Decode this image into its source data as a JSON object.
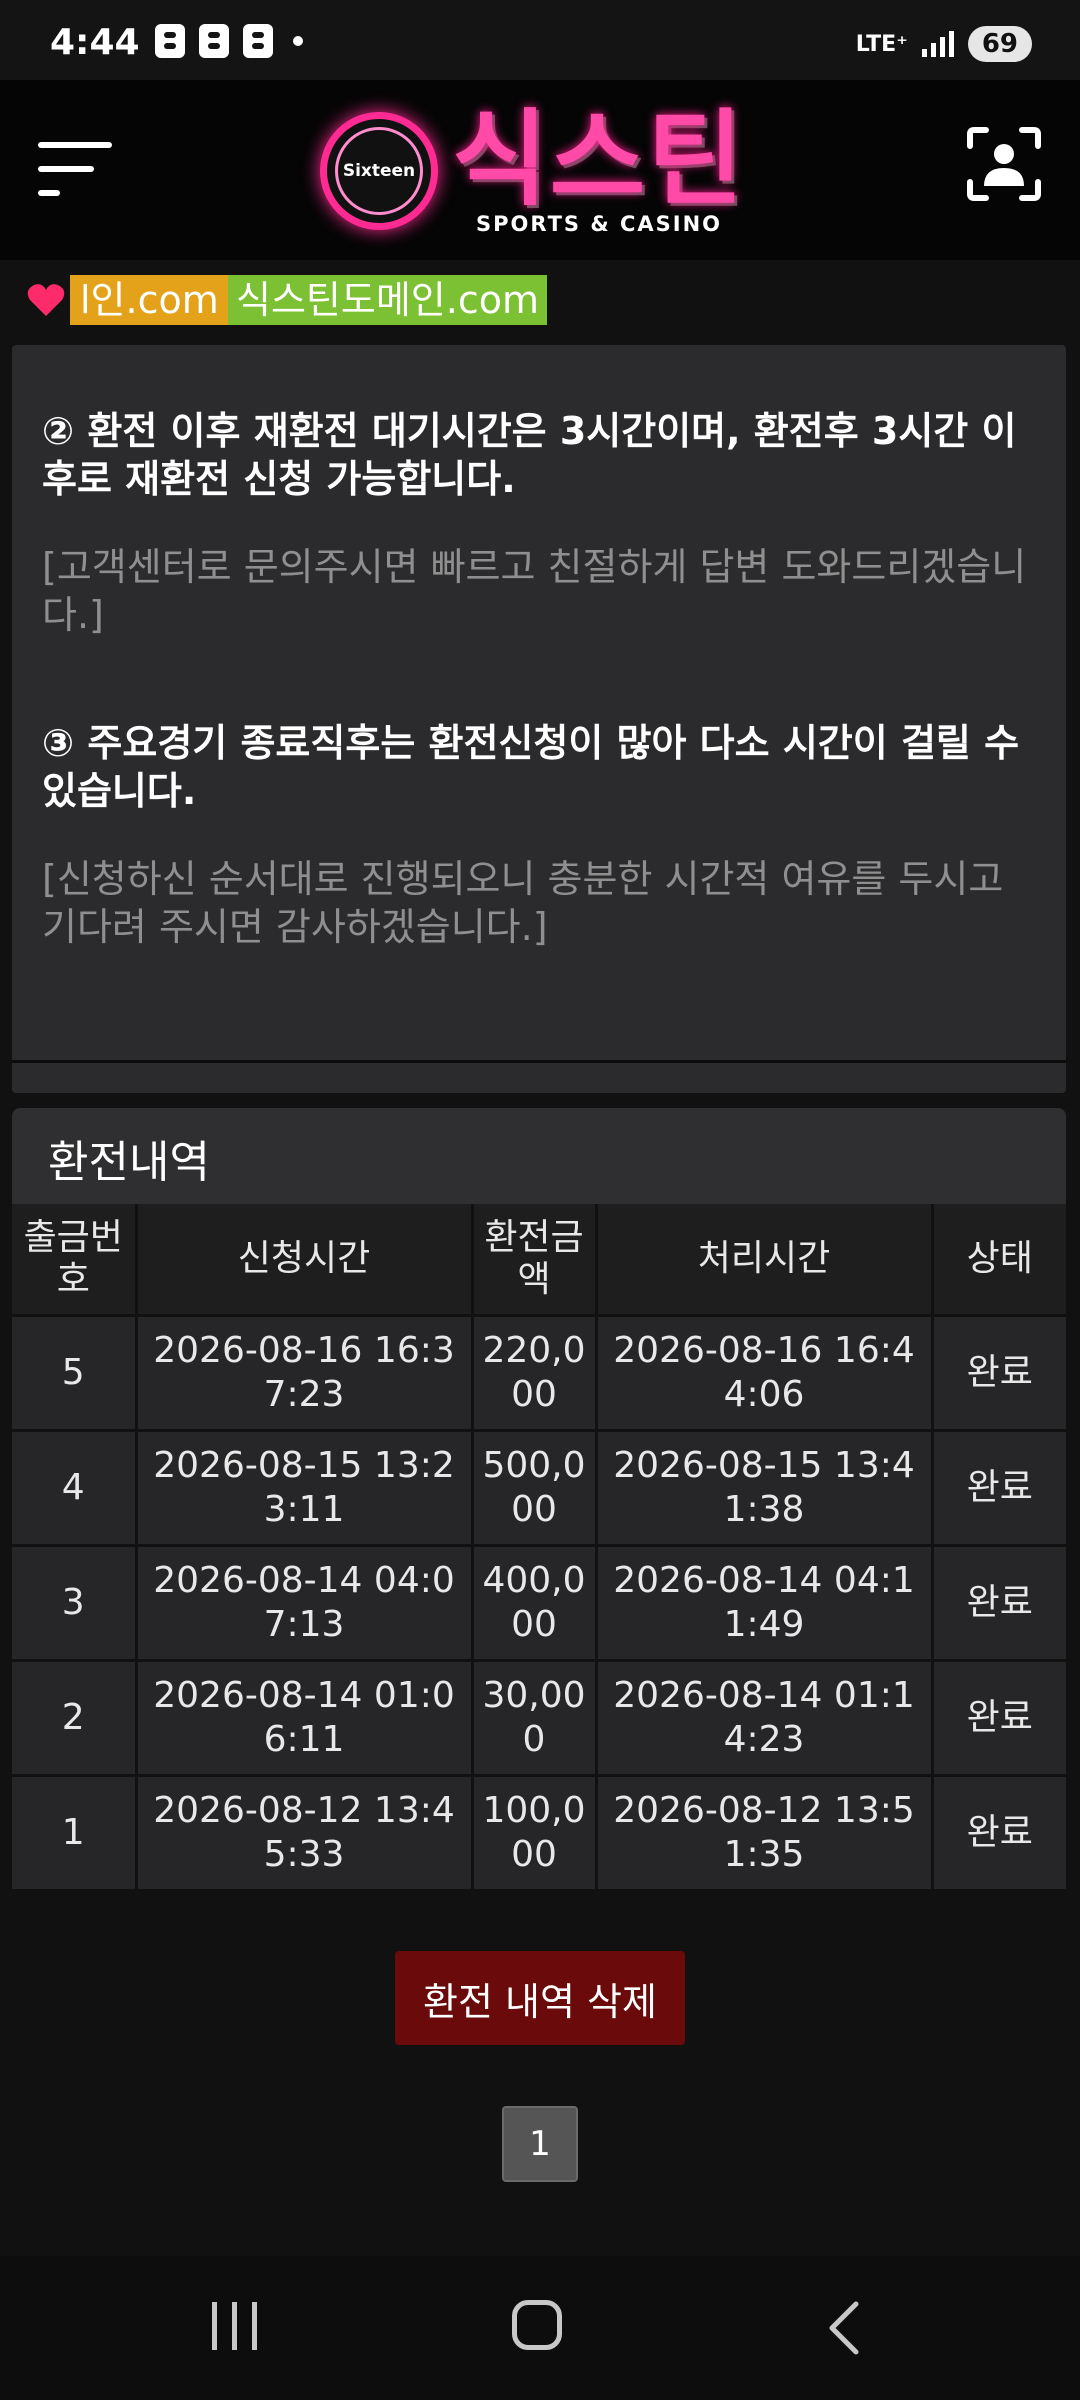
{
  "status_bar": {
    "time": "4:44",
    "network": "LTE⁺",
    "battery": "69"
  },
  "header": {
    "logo_badge": "Sixteen",
    "logo_title": "식스틴",
    "logo_subtitle": "SPORTS & CASINO"
  },
  "domains": {
    "first": "l인.com",
    "second": "식스틴도메인.com",
    "first_color": "#e3a21a",
    "second_color": "#7cc033"
  },
  "notice": {
    "item2_head": "② 환전 이후 재환전 대기시간은 3시간이며, 환전후 3시간 이후로 재환전 신청 가능합니다.",
    "item2_sub": "[고객센터로 문의주시면 빠르고 친절하게 답변 도와드리겠습니다.]",
    "item3_head": "③ 주요경기 종료직후는 환전신청이 많아 다소 시간이 걸릴 수 있습니다.",
    "item3_sub": "[신청하신 순서대로 진행되오니 충분한 시간적 여유를 두시고 기다려 주시면 감사하겠습니다.]"
  },
  "history": {
    "title": "환전내역",
    "columns": [
      "출금번호",
      "신청시간",
      "환전금액",
      "처리시간",
      "상태"
    ],
    "rows": [
      {
        "no": "5",
        "requested": "2026-08-16 16:37:23",
        "amount": "220,000",
        "processed": "2026-08-16 16:44:06",
        "status": "완료"
      },
      {
        "no": "4",
        "requested": "2026-08-15 13:23:11",
        "amount": "500,000",
        "processed": "2026-08-15 13:41:38",
        "status": "완료"
      },
      {
        "no": "3",
        "requested": "2026-08-14 04:07:13",
        "amount": "400,000",
        "processed": "2026-08-14 04:11:49",
        "status": "완료"
      },
      {
        "no": "2",
        "requested": "2026-08-14 01:06:11",
        "amount": "30,000",
        "processed": "2026-08-14 01:14:23",
        "status": "완료"
      },
      {
        "no": "1",
        "requested": "2026-08-12 13:45:33",
        "amount": "100,000",
        "processed": "2026-08-12 13:51:35",
        "status": "완료"
      }
    ]
  },
  "actions": {
    "delete_label": "환전 내역 삭제",
    "page": "1"
  },
  "colors": {
    "accent": "#ff2a92",
    "delete_button": "#6a0a0a"
  }
}
